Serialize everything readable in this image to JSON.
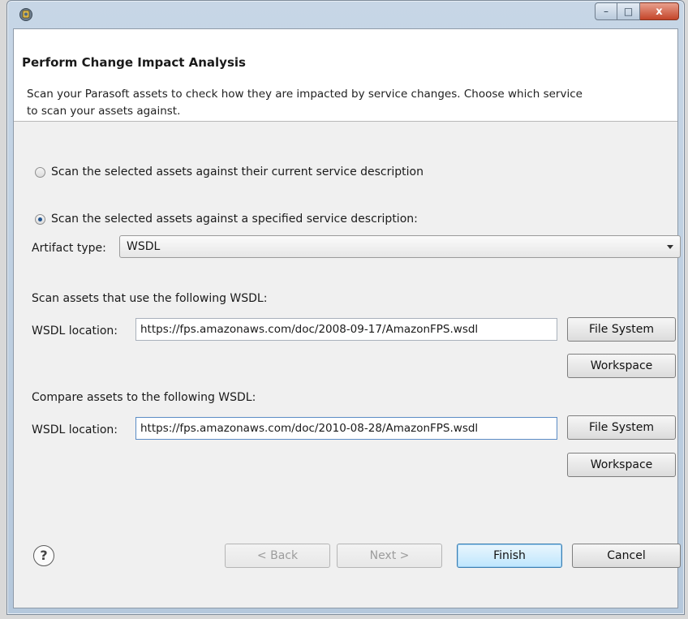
{
  "window": {
    "title": "",
    "controls": {
      "minimize": "–",
      "maximize": "□",
      "close": "x"
    }
  },
  "banner": {
    "title": "Perform Change Impact Analysis",
    "description": "Scan your Parasoft assets to check how they are impacted by service changes.  Choose which service to scan your assets against."
  },
  "options": {
    "current_label": "Scan the selected assets against their current service description",
    "current_selected": false,
    "specified_label": "Scan the selected assets against a specified service description:",
    "specified_selected": true
  },
  "artifact": {
    "label": "Artifact type:",
    "value": "WSDL"
  },
  "scan_section": {
    "heading": "Scan assets that use the following WSDL:",
    "location_label": "WSDL location:",
    "location_value": "https://fps.amazonaws.com/doc/2008-09-17/AmazonFPS.wsdl",
    "file_system_label": "File System",
    "workspace_label": "Workspace"
  },
  "compare_section": {
    "heading": "Compare assets to the following WSDL:",
    "location_label": "WSDL location:",
    "location_value": "https://fps.amazonaws.com/doc/2010-08-28/AmazonFPS.wsdl",
    "file_system_label": "File System",
    "workspace_label": "Workspace"
  },
  "footer": {
    "help_label": "?",
    "back_label": "< Back",
    "next_label": "Next >",
    "finish_label": "Finish",
    "cancel_label": "Cancel"
  },
  "colors": {
    "accent": "#3c7fb1",
    "close_button": "#c4452a",
    "dialog_background": "#f0f0f0"
  },
  "icons": {
    "app": "parasoft-app-icon",
    "help": "help-icon",
    "dropdown": "chevron-down-icon"
  }
}
